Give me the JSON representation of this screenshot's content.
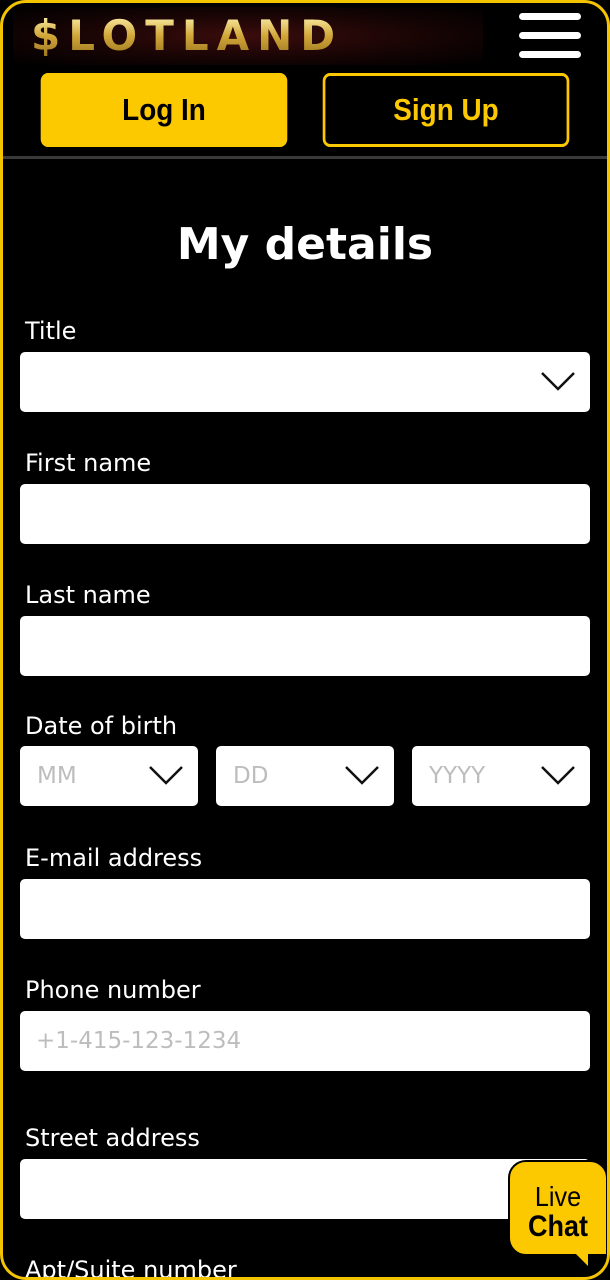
{
  "header": {
    "logo_text": "$LOTLAND",
    "menu_icon": "hamburger-menu-icon"
  },
  "auth": {
    "login_label": "Log In",
    "signup_label": "Sign Up"
  },
  "form": {
    "heading": "My details",
    "title": {
      "label": "Title",
      "value": ""
    },
    "first_name": {
      "label": "First name",
      "value": ""
    },
    "last_name": {
      "label": "Last name",
      "value": ""
    },
    "dob": {
      "label": "Date of birth",
      "month_placeholder": "MM",
      "day_placeholder": "DD",
      "year_placeholder": "YYYY"
    },
    "email": {
      "label": "E-mail address",
      "value": ""
    },
    "phone": {
      "label": "Phone number",
      "placeholder": "+1-415-123-1234"
    },
    "street": {
      "label": "Street address",
      "value": ""
    },
    "apt": {
      "label": "Apt/Suite number"
    }
  },
  "live_chat": {
    "line1": "Live",
    "line2": "Chat"
  },
  "colors": {
    "accent": "#fcc800",
    "background": "#000000",
    "field_background": "#ffffff"
  }
}
